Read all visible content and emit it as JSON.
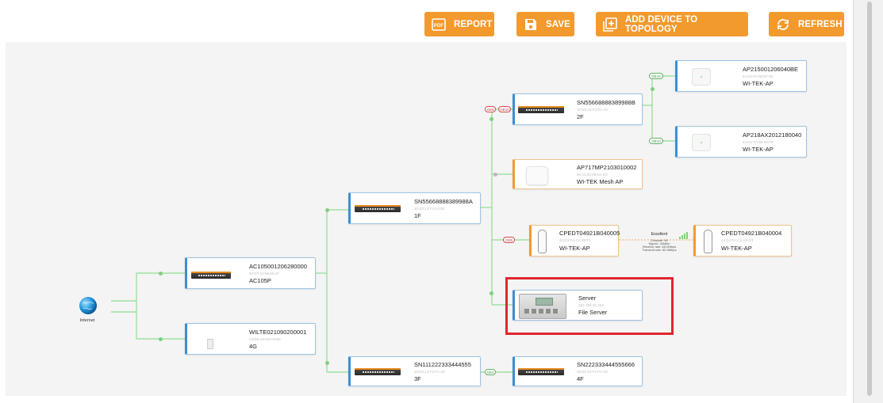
{
  "toolbar": {
    "report_label": "REPORT",
    "save_label": "SAVE",
    "add_device_label": "ADD DEVICE TO TOPOLOGY",
    "refresh_label": "REFRESH",
    "accent_color": "#f39a2e"
  },
  "internet": {
    "label": "Internet",
    "icon": "globe-icon"
  },
  "devices": {
    "ac105": {
      "name": "AC105001206280000",
      "sub": "44:D7:10:99:90:1F",
      "model": "AC105P",
      "icon": "router-icon"
    },
    "wilte": {
      "name": "WILTE021090200001",
      "sub": "C8:6E:A6:58:F8:5D",
      "model": "4G",
      "icon": "lte-modem-icon"
    },
    "sw1f": {
      "name": "SN55668888389988A",
      "sub": "10:E0:13:F1:FA:52",
      "model": "1F",
      "icon": "switch-icon"
    },
    "sw3f": {
      "name": "SN111222333444555",
      "sub": "10:E0:13:F1:FA:A0",
      "model": "3F",
      "icon": "switch-icon"
    },
    "sw2f": {
      "name": "SN55668888389988B",
      "sub": "10:E0:13:F1:FA:A0",
      "model": "2F",
      "icon": "switch-icon"
    },
    "mesh": {
      "name": "AP717MP2103010002",
      "sub": "60:41:83:9B:5A:D3",
      "model": "WI-TEK Mesh AP",
      "icon": "mesh-ap-icon"
    },
    "cpe1": {
      "name": "CPEDT04921B040005",
      "sub": "44:D1:FA:CA:83:F1",
      "model": "WI-TEK-AP",
      "icon": "cpe-icon"
    },
    "cpe2": {
      "name": "CPEDT04921B040004",
      "sub": "44:D1:FA:CA:83:D3",
      "model": "WI-TEK-AP",
      "icon": "cpe-icon"
    },
    "server": {
      "name": "Server",
      "sub": "192.168.20.253",
      "model": "File Server",
      "icon": "server-icon"
    },
    "sw4f": {
      "name": "SN222333444555666",
      "sub": "10:E0:13:F1:FA:A0",
      "model": "4F",
      "icon": "switch-icon"
    },
    "ap1": {
      "name": "AP215001206040BE",
      "sub": "44:D1:FA:88:87:8C",
      "model": "WI-TEK-AP",
      "icon": "ceiling-ap-icon"
    },
    "ap2": {
      "name": "AP218AX2012180040",
      "sub": "44:D1:FA:88:82:F6",
      "model": "WI-TEK-AP",
      "icon": "ceiling-ap-icon"
    }
  },
  "ports": {
    "sw2f_in": "GE6",
    "sw2f_out": "GE10",
    "ap1_port": "GE10",
    "ap2_port": "GE10",
    "cpe1_port": "GE5",
    "sw4f_port": "GE4"
  },
  "mesh_link": {
    "quality": "Excellent",
    "channel": "Channel: 40",
    "signal": "Signal: -58dbm",
    "rx": "Receive rate: 65.0Mbps",
    "tx": "Transmit rate: 65.0Mbps"
  }
}
